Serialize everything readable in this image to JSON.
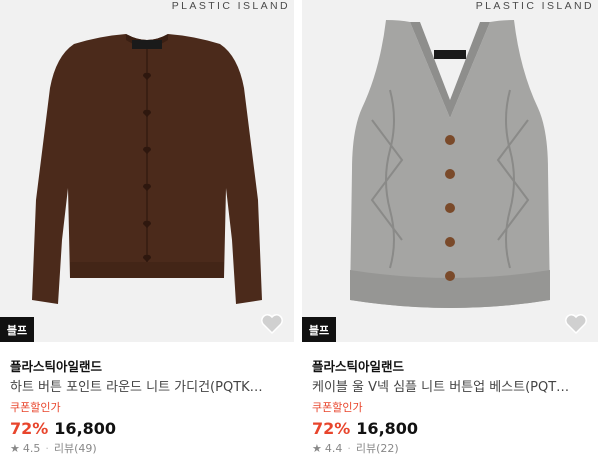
{
  "products": [
    {
      "watermark": "PLASTIC ISLAND",
      "badge": "블프",
      "brand": "플라스틱아일랜드",
      "title": "하트 버튼 포인트 라운드 니트 가디건(PQTK…",
      "coupon": "쿠폰할인가",
      "discount": "72%",
      "price": "16,800",
      "rating": "4.5",
      "reviews": "리뷰(49)",
      "colors": {
        "garment": "#4b2a1b",
        "accent": "#e8452c"
      },
      "icons": [
        "cardigan-image",
        "heart-icon",
        "star-icon"
      ]
    },
    {
      "watermark": "PLASTIC ISLAND",
      "badge": "블프",
      "brand": "플라스틱아일랜드",
      "title": "케이블 울 V넥 심플 니트 버튼업 베스트(PQT…",
      "coupon": "쿠폰할인가",
      "discount": "72%",
      "price": "16,800",
      "rating": "4.4",
      "reviews": "리뷰(22)",
      "colors": {
        "garment": "#a5a5a3",
        "accent": "#e8452c"
      },
      "icons": [
        "vest-image",
        "heart-icon",
        "star-icon"
      ]
    }
  ]
}
